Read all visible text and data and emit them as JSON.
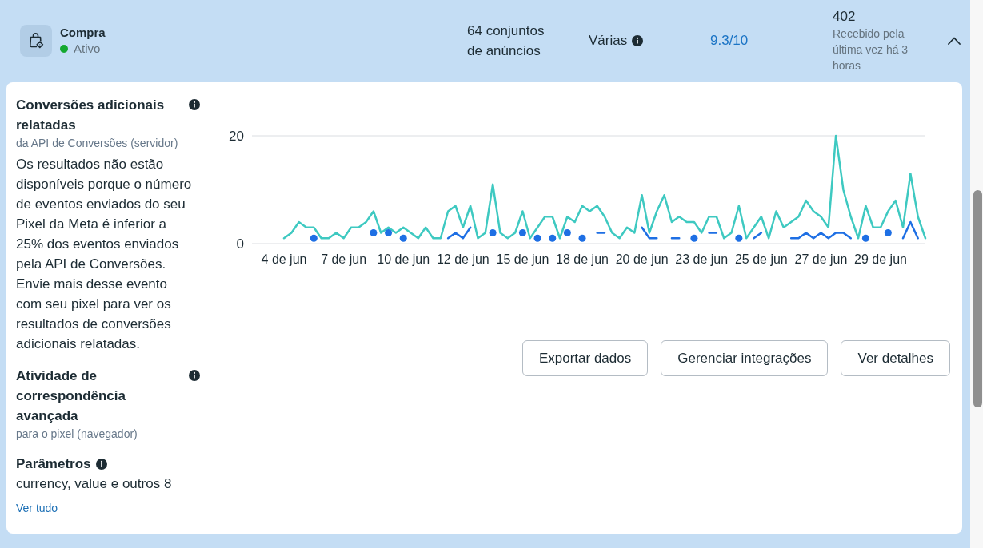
{
  "event": {
    "name": "Compra",
    "status": "Ativo",
    "active": true,
    "ad_sets": "64 conjuntos de anúncios",
    "column_3": "Várias",
    "column_4": "9.3/10",
    "received": {
      "count": "402",
      "note": "Recebido pela última vez há 3 horas"
    },
    "expanded": true
  },
  "details": {
    "sections": [
      {
        "kind": "metric",
        "title": "Conversões adicionais relatadas",
        "subtitle": "da API de Conversões (servidor)",
        "text": "Os resultados não estão disponíveis porque o número de eventos enviados do seu Pixel da Meta é inferior a 25% dos eventos enviados pela API de Conversões. Envie mais desse evento com seu pixel para ver os resultados de conversões adicionais relatadas."
      },
      {
        "kind": "metric",
        "title": "Atividade de correspondência avançada",
        "subtitle": "para o pixel (navegador)"
      },
      {
        "kind": "parameters",
        "title": "Parâmetros",
        "text": "currency, value e outros 8",
        "link": "Ver tudo"
      }
    ],
    "chart": {
      "chart_data": {
        "type": "line",
        "categories": [
          "4 de jun",
          null,
          null,
          null,
          null,
          null,
          null,
          null,
          "7 de jun",
          null,
          null,
          null,
          null,
          null,
          null,
          null,
          "10 de jun",
          null,
          null,
          null,
          null,
          null,
          null,
          null,
          "12 de jun",
          null,
          null,
          null,
          null,
          null,
          null,
          null,
          "15 de jun",
          null,
          null,
          null,
          null,
          null,
          null,
          null,
          "18 de jun",
          null,
          null,
          null,
          null,
          null,
          null,
          null,
          "20 de jun",
          null,
          null,
          null,
          null,
          null,
          null,
          null,
          "23 de jun",
          null,
          null,
          null,
          null,
          null,
          null,
          null,
          "25 de jun",
          null,
          null,
          null,
          null,
          null,
          null,
          null,
          "27 de jun",
          null,
          null,
          null,
          null,
          null,
          null,
          null,
          "29 de jun",
          null,
          null,
          null,
          null,
          null,
          null
        ],
        "series": [
          {
            "color": "#3ec9c1",
            "values": [
              1,
              2,
              4,
              3,
              3,
              1,
              1,
              2,
              1,
              3,
              3,
              4,
              6,
              2,
              3,
              2,
              3,
              2,
              1,
              3,
              1,
              1,
              6,
              7,
              3,
              7,
              1,
              2,
              11,
              2,
              1,
              2,
              6,
              1,
              3,
              5,
              5,
              1,
              5,
              4,
              7,
              6,
              7,
              5,
              2,
              1,
              3,
              2,
              9,
              2,
              6,
              9,
              4,
              5,
              4,
              4,
              2,
              5,
              5,
              1,
              2,
              7,
              1,
              3,
              5,
              1,
              6,
              3,
              4,
              5,
              8,
              6,
              5,
              3,
              20,
              10,
              5,
              1,
              7,
              3,
              3,
              6,
              8,
              3,
              13,
              5,
              1
            ]
          },
          {
            "color": "#1e6fe4",
            "values": [
              null,
              null,
              null,
              null,
              1,
              null,
              null,
              null,
              null,
              null,
              null,
              null,
              2,
              null,
              2,
              null,
              1,
              null,
              null,
              null,
              null,
              null,
              1,
              2,
              1,
              3,
              null,
              null,
              2,
              null,
              null,
              null,
              2,
              null,
              1,
              null,
              1,
              null,
              2,
              null,
              1,
              null,
              2,
              2,
              null,
              null,
              null,
              null,
              3,
              1,
              1,
              null,
              1,
              1,
              null,
              1,
              null,
              2,
              2,
              null,
              null,
              1,
              null,
              1,
              2,
              null,
              null,
              null,
              1,
              1,
              2,
              1,
              2,
              1,
              2,
              2,
              1,
              null,
              1,
              null,
              null,
              2,
              null,
              1,
              4,
              1,
              null
            ]
          }
        ],
        "ylim": [
          0,
          20
        ],
        "yticks": [
          0,
          20
        ]
      }
    },
    "buttons": [
      "Exportar dados",
      "Gerenciar integrações",
      "Ver detalhes"
    ]
  }
}
